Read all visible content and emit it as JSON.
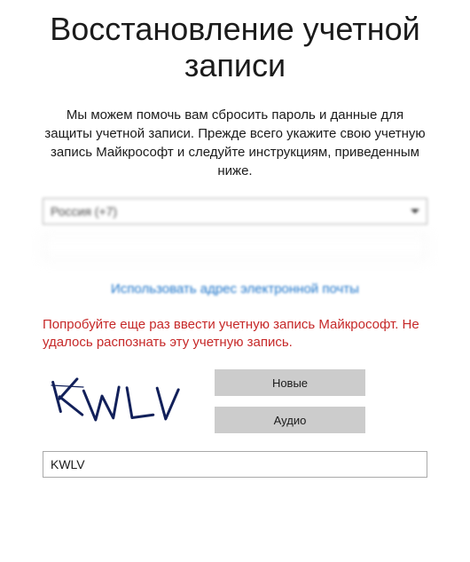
{
  "title": "Восстановление учетной записи",
  "help_text": "Мы можем помочь вам сбросить пароль и данные для защиты учетной записи. Прежде всего укажите свою учетную запись Майкрософт и следуйте инструкциям, приведенным ниже.",
  "country_select": {
    "selected_label": "Россия (+7)"
  },
  "phone_input": {
    "value": ""
  },
  "use_email_link": "Использовать адрес электронной почты",
  "error_message": "Попробуйте еще раз ввести учетную запись Майкрософт. Не удалось распознать эту учетную запись.",
  "captcha": {
    "image_text": "KWLV",
    "new_button": "Новые",
    "audio_button": "Аудио",
    "input_value": "KWLV"
  },
  "colors": {
    "link_blue": "#1b73c9",
    "error_red": "#c62828",
    "button_gray": "#cccccc",
    "border_gray": "#a9a9a9"
  }
}
